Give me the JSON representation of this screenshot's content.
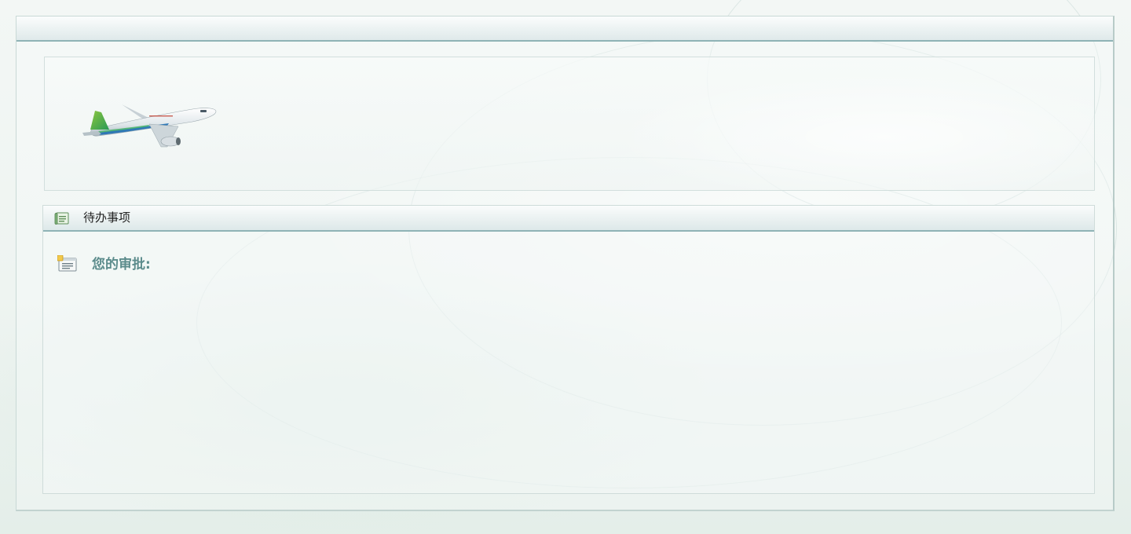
{
  "banner": {
    "plane_icon": "airplane-illustration"
  },
  "todo": {
    "header_icon": "task-list-icon",
    "title": "待办事项",
    "approval": {
      "icon": "document-list-icon",
      "label": "您的审批:"
    }
  },
  "colors": {
    "header_border": "#8fb3b6",
    "approval_text": "#5c8c8c",
    "background": "#eef4f1"
  }
}
